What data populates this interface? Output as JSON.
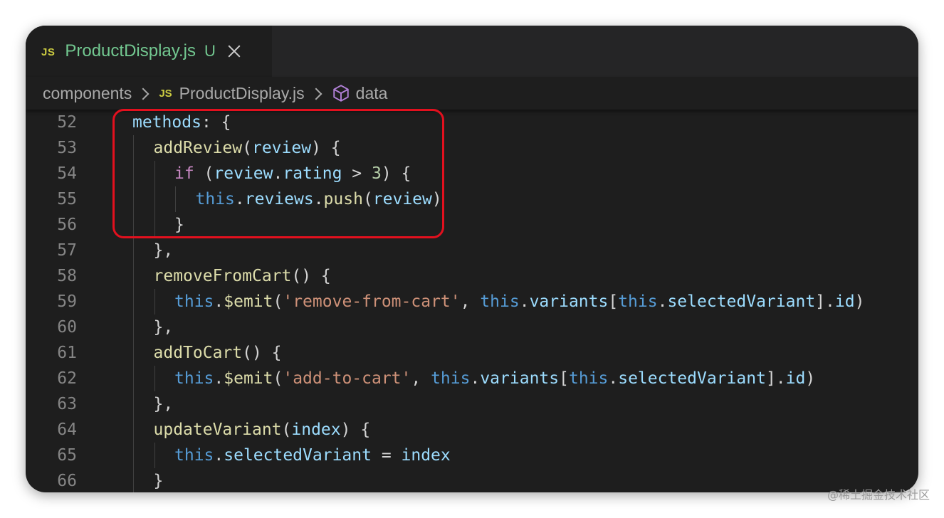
{
  "tab": {
    "badge": "JS",
    "filename": "ProductDisplay.js",
    "status": "U"
  },
  "breadcrumb": {
    "folder": "components",
    "badge": "JS",
    "file": "ProductDisplay.js",
    "symbol": "data",
    "symbol_icon": "cube-icon"
  },
  "colors": {
    "highlight_box": "#e3101e",
    "modified_file": "#73c991",
    "js_badge": "#cbcb41"
  },
  "code_lines": [
    {
      "number": "52",
      "tokens": [
        [
          "t-var",
          "methods"
        ],
        [
          "t-punc",
          ": {"
        ]
      ]
    },
    {
      "number": "53",
      "tokens": [
        [
          "t-fn",
          "addReview"
        ],
        [
          "t-punc",
          "("
        ],
        [
          "t-var",
          "review"
        ],
        [
          "t-punc",
          ") {"
        ]
      ]
    },
    {
      "number": "54",
      "tokens": [
        [
          "t-kw",
          "if"
        ],
        [
          "t-punc",
          " ("
        ],
        [
          "t-var",
          "review"
        ],
        [
          "t-punc",
          "."
        ],
        [
          "t-var",
          "rating"
        ],
        [
          "t-punc",
          " > "
        ],
        [
          "t-num",
          "3"
        ],
        [
          "t-punc",
          ") {"
        ]
      ]
    },
    {
      "number": "55",
      "tokens": [
        [
          "t-this",
          "this"
        ],
        [
          "t-punc",
          "."
        ],
        [
          "t-var",
          "reviews"
        ],
        [
          "t-punc",
          "."
        ],
        [
          "t-fn",
          "push"
        ],
        [
          "t-punc",
          "("
        ],
        [
          "t-var",
          "review"
        ],
        [
          "t-punc",
          ")"
        ]
      ]
    },
    {
      "number": "56",
      "tokens": [
        [
          "t-punc",
          "}"
        ]
      ]
    },
    {
      "number": "57",
      "tokens": [
        [
          "t-punc",
          "},"
        ]
      ]
    },
    {
      "number": "58",
      "tokens": [
        [
          "t-fn",
          "removeFromCart"
        ],
        [
          "t-punc",
          "() {"
        ]
      ]
    },
    {
      "number": "59",
      "tokens": [
        [
          "t-this",
          "this"
        ],
        [
          "t-punc",
          "."
        ],
        [
          "t-fn",
          "$emit"
        ],
        [
          "t-punc",
          "("
        ],
        [
          "t-str",
          "'remove-from-cart'"
        ],
        [
          "t-punc",
          ", "
        ],
        [
          "t-this",
          "this"
        ],
        [
          "t-punc",
          "."
        ],
        [
          "t-var",
          "variants"
        ],
        [
          "t-punc",
          "["
        ],
        [
          "t-this",
          "this"
        ],
        [
          "t-punc",
          "."
        ],
        [
          "t-var",
          "selectedVariant"
        ],
        [
          "t-punc",
          "]."
        ],
        [
          "t-var",
          "id"
        ],
        [
          "t-punc",
          ")"
        ]
      ]
    },
    {
      "number": "60",
      "tokens": [
        [
          "t-punc",
          "},"
        ]
      ]
    },
    {
      "number": "61",
      "tokens": [
        [
          "t-fn",
          "addToCart"
        ],
        [
          "t-punc",
          "() {"
        ]
      ]
    },
    {
      "number": "62",
      "tokens": [
        [
          "t-this",
          "this"
        ],
        [
          "t-punc",
          "."
        ],
        [
          "t-fn",
          "$emit"
        ],
        [
          "t-punc",
          "("
        ],
        [
          "t-str",
          "'add-to-cart'"
        ],
        [
          "t-punc",
          ", "
        ],
        [
          "t-this",
          "this"
        ],
        [
          "t-punc",
          "."
        ],
        [
          "t-var",
          "variants"
        ],
        [
          "t-punc",
          "["
        ],
        [
          "t-this",
          "this"
        ],
        [
          "t-punc",
          "."
        ],
        [
          "t-var",
          "selectedVariant"
        ],
        [
          "t-punc",
          "]."
        ],
        [
          "t-var",
          "id"
        ],
        [
          "t-punc",
          ")"
        ]
      ]
    },
    {
      "number": "63",
      "tokens": [
        [
          "t-punc",
          "},"
        ]
      ]
    },
    {
      "number": "64",
      "tokens": [
        [
          "t-fn",
          "updateVariant"
        ],
        [
          "t-punc",
          "("
        ],
        [
          "t-var",
          "index"
        ],
        [
          "t-punc",
          ") {"
        ]
      ]
    },
    {
      "number": "65",
      "tokens": [
        [
          "t-this",
          "this"
        ],
        [
          "t-punc",
          "."
        ],
        [
          "t-var",
          "selectedVariant"
        ],
        [
          "t-punc",
          " = "
        ],
        [
          "t-var",
          "index"
        ]
      ]
    },
    {
      "number": "66",
      "tokens": [
        [
          "t-punc",
          "}"
        ]
      ]
    }
  ],
  "watermark": "@稀土掘金技术社区"
}
